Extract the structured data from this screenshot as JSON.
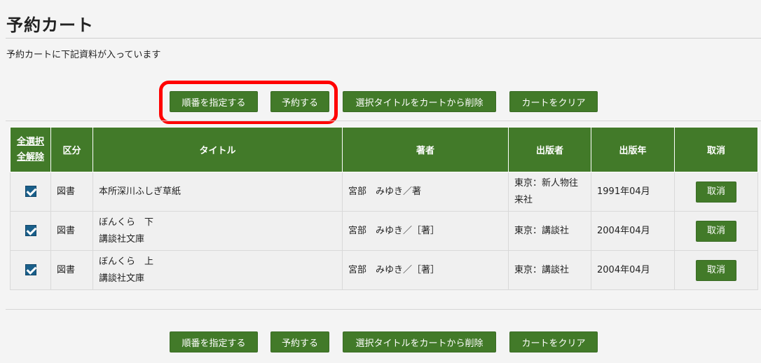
{
  "page": {
    "title": "予約カート",
    "subtitle": "予約カートに下記資料が入っています"
  },
  "toolbar": {
    "order_label": "順番を指定する",
    "reserve_label": "予約する",
    "remove_selected_label": "選択タイトルをカートから削除",
    "clear_label": "カートをクリア"
  },
  "table": {
    "headers": {
      "select_all": "全選択",
      "deselect_all": "全解除",
      "category": "区分",
      "title": "タイトル",
      "author": "著者",
      "publisher": "出版者",
      "year": "出版年",
      "cancel": "取消"
    },
    "rows": [
      {
        "checked": true,
        "category": "図書",
        "title": "本所深川ふしぎ草紙",
        "series": "",
        "author": "宮部　みゆき／著",
        "publisher_line1": "東京：新人物往",
        "publisher_line2": "来社",
        "year": "1991年04月",
        "cancel_label": "取消"
      },
      {
        "checked": true,
        "category": "図書",
        "title": "ぼんくら　下",
        "series": "講談社文庫",
        "author": "宮部　みゆき／［著］",
        "publisher_line1": "東京：講談社",
        "publisher_line2": "",
        "year": "2004年04月",
        "cancel_label": "取消"
      },
      {
        "checked": true,
        "category": "図書",
        "title": "ぼんくら　上",
        "series": "講談社文庫",
        "author": "宮部　みゆき／［著］",
        "publisher_line1": "東京：講談社",
        "publisher_line2": "",
        "year": "2004年04月",
        "cancel_label": "取消"
      }
    ]
  },
  "colors": {
    "accent": "#427a29",
    "highlight": "#ff0000",
    "checkbox": "#1a5f8a"
  }
}
